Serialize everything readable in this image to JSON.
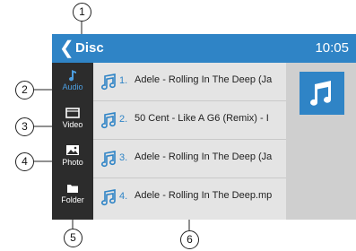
{
  "topbar": {
    "back_icon": "chevron-left-icon",
    "title": "Disc",
    "time": "10:05"
  },
  "sidebar": {
    "items": [
      {
        "label": "Audio",
        "icon": "music-note-icon",
        "active": true
      },
      {
        "label": "Video",
        "icon": "video-icon",
        "active": false
      },
      {
        "label": "Photo",
        "icon": "photo-icon",
        "active": false
      },
      {
        "label": "Folder",
        "icon": "folder-icon",
        "active": false
      }
    ]
  },
  "tracks": [
    {
      "num": "1.",
      "title": "Adele - Rolling In The Deep (Ja"
    },
    {
      "num": "2.",
      "title": "50 Cent - Like A G6 (Remix) - I"
    },
    {
      "num": "3.",
      "title": "Adele - Rolling In The Deep (Ja"
    },
    {
      "num": "4.",
      "title": "Adele - Rolling In The Deep.mp"
    }
  ],
  "album_art_icon": "music-note-icon",
  "callouts": [
    "1",
    "2",
    "3",
    "4",
    "5",
    "6"
  ],
  "colors": {
    "accent": "#2f84c6",
    "sidebar": "#2c2c2c",
    "list_bg": "#e4e4e4",
    "active_label": "#4c9ee0"
  }
}
